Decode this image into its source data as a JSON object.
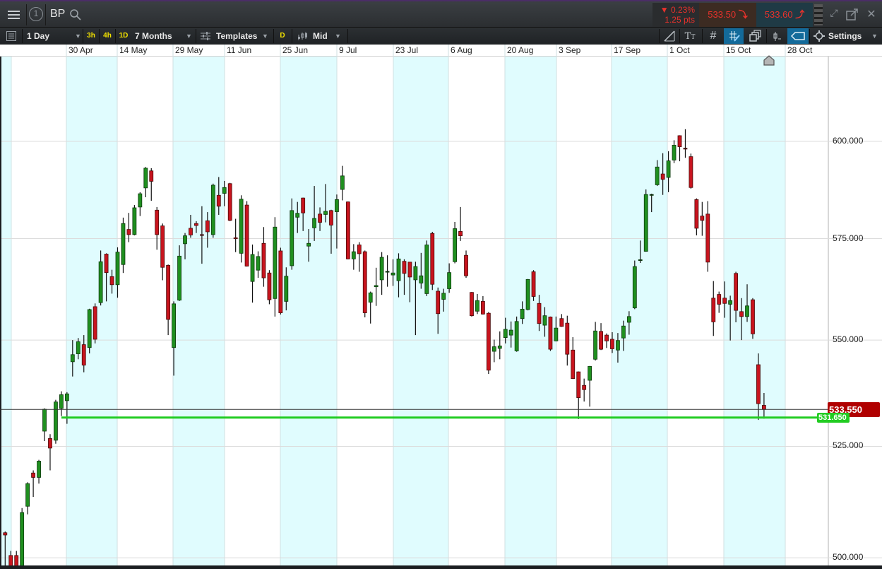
{
  "header": {
    "menu_icon": "hamburger-icon",
    "layout_number": "1",
    "symbol": "BP",
    "change_pct": "▼ 0.23%",
    "change_pts": "1.25 pts",
    "sell_price": "533.50",
    "buy_price": "533.60",
    "colors": {
      "down": "#e8322c",
      "sell_bg": "#3c2b22",
      "buy_bg": "#1f3a45"
    }
  },
  "toolbar": {
    "interval": "1 Day",
    "quick_intervals": [
      "3h",
      "4h",
      "1D"
    ],
    "range": "7 Months",
    "templates": "Templates",
    "d_badge": "D",
    "price_type": "Mid",
    "settings": "Settings"
  },
  "chart_data": {
    "type": "candlestick",
    "title": "BP",
    "scale": "log",
    "ylim": [
      499,
      625.8
    ],
    "x_tick_labels": [
      "30 Apr",
      "14 May",
      "29 May",
      "11 Jun",
      "25 Jun",
      "9 Jul",
      "23 Jul",
      "6 Aug",
      "20 Aug",
      "3 Sep",
      "17 Sep",
      "1 Oct",
      "15 Oct",
      "28 Oct"
    ],
    "y_ticks": [
      600,
      575,
      550,
      525,
      500
    ],
    "y_tick_labels": [
      "600.000",
      "575.000",
      "550.000",
      "525.000",
      "500.000"
    ],
    "current_price": 533.55,
    "current_price_label": "533.550",
    "horizontal_line": 531.65,
    "horizontal_line_label": "531.650",
    "colors": {
      "up": "#1f8f1f",
      "down": "#c8141e",
      "line": "#22cc22",
      "current": "#b00000"
    },
    "ohlc_fields": [
      "open",
      "high",
      "low",
      "close"
    ],
    "candles": [
      [
        505.5,
        505.8,
        498,
        505
      ],
      [
        500.5,
        501.5,
        497,
        498
      ],
      [
        500.5,
        501.5,
        497,
        498
      ],
      [
        498,
        511,
        497,
        510
      ],
      [
        511.4,
        516.8,
        509.6,
        516.5
      ],
      [
        518.9,
        519.5,
        513.5,
        517.9
      ],
      [
        517.9,
        521.9,
        516.5,
        521.6
      ],
      [
        528.5,
        533.8,
        526.2,
        533.6
      ],
      [
        526.8,
        527.8,
        519.5,
        524.6
      ],
      [
        526.4,
        535.8,
        525.6,
        535.3
      ],
      [
        533.8,
        537.8,
        532,
        537
      ],
      [
        535.6,
        537.6,
        530.2,
        537.2
      ],
      [
        544.8,
        550,
        541.3,
        546.5
      ],
      [
        546.7,
        550.5,
        545.4,
        549.6
      ],
      [
        548.9,
        551.2,
        542.3,
        544
      ],
      [
        548.2,
        557.6,
        546.8,
        557.4
      ],
      [
        558.1,
        558.9,
        549.2,
        550.2
      ],
      [
        559.1,
        572,
        558.4,
        569.2
      ],
      [
        571.1,
        571.3,
        559.4,
        566.5
      ],
      [
        565.5,
        567.2,
        561.3,
        563.5
      ],
      [
        563.5,
        572.8,
        560.3,
        571.6
      ],
      [
        568.5,
        580.3,
        566.4,
        578.8
      ],
      [
        577.3,
        581.5,
        574.1,
        576
      ],
      [
        576,
        583.5,
        575.8,
        582.8
      ],
      [
        583,
        586.8,
        580.7,
        586.4
      ],
      [
        587.9,
        593.3,
        585.5,
        593
      ],
      [
        592.3,
        593,
        584.6,
        589.6
      ],
      [
        582.2,
        583,
        572.2,
        576
      ],
      [
        578.2,
        578.8,
        564.6,
        567.8
      ],
      [
        568.3,
        568.5,
        551.2,
        555
      ],
      [
        548.2,
        559.4,
        541.5,
        558.8
      ],
      [
        559.7,
        573.3,
        559.5,
        570.6
      ],
      [
        573.7,
        576.4,
        569.8,
        575.7
      ],
      [
        577.6,
        581,
        575.2,
        575.9
      ],
      [
        578.8,
        579.4,
        576.4,
        578.3
      ],
      [
        576,
        583.2,
        568.7,
        575.9
      ],
      [
        579.5,
        581.7,
        572.7,
        576.7
      ],
      [
        576,
        589,
        575.2,
        588.6
      ],
      [
        586,
        590.7,
        581,
        583.2
      ],
      [
        586.5,
        589.7,
        583.2,
        588
      ],
      [
        589,
        589.2,
        579.4,
        579.6
      ],
      [
        575.2,
        580,
        571.6,
        575
      ],
      [
        571.3,
        586,
        569,
        585
      ],
      [
        583.5,
        584.5,
        568,
        568.1
      ],
      [
        564.3,
        573.5,
        559.1,
        571
      ],
      [
        567.1,
        571.8,
        565.2,
        570.5
      ],
      [
        573.8,
        577.9,
        563,
        565.2
      ],
      [
        566.4,
        567.1,
        558.7,
        559.8
      ],
      [
        560.1,
        580.4,
        555.7,
        577.9
      ],
      [
        571.9,
        572.7,
        556.2,
        556.6
      ],
      [
        559.4,
        567.8,
        557.2,
        565.6
      ],
      [
        568.2,
        585.2,
        567.2,
        582.1
      ],
      [
        580.4,
        584.3,
        576.4,
        581.4
      ],
      [
        585.3,
        585.4,
        576.9,
        581.5
      ],
      [
        573.1,
        577.4,
        569.2,
        573.8
      ],
      [
        577.7,
        588.4,
        574.4,
        580.1
      ],
      [
        581.2,
        582.9,
        576.9,
        579.1
      ],
      [
        581.1,
        588.9,
        579.1,
        581.9
      ],
      [
        582.1,
        582.3,
        571.2,
        578.4
      ],
      [
        581.8,
        586.2,
        572.5,
        584.9
      ],
      [
        587.5,
        593.6,
        584.7,
        591
      ],
      [
        584.3,
        584.4,
        569.8,
        569.9
      ],
      [
        569.9,
        573.6,
        567.2,
        571.7
      ],
      [
        573.4,
        574.1,
        566.7,
        571.2
      ],
      [
        571.7,
        572,
        555.5,
        556.6
      ],
      [
        559.2,
        561.8,
        554,
        561.5
      ],
      [
        563,
        567.7,
        558.3,
        563.3
      ],
      [
        564.7,
        571.6,
        561,
        570.3
      ],
      [
        566.7,
        570.8,
        563,
        566.8
      ],
      [
        565.9,
        569.8,
        563.2,
        566.4
      ],
      [
        564.5,
        571.3,
        560.4,
        569.9
      ],
      [
        569.3,
        569.8,
        561,
        566.3
      ],
      [
        569.1,
        569.1,
        559.2,
        565.4
      ],
      [
        564.7,
        569.2,
        551.2,
        568
      ],
      [
        563.9,
        571.4,
        562.5,
        565.7
      ],
      [
        561.3,
        574.5,
        560.7,
        573.4
      ],
      [
        576.3,
        576.7,
        562.2,
        563.6
      ],
      [
        561.9,
        562.8,
        551.5,
        556.4
      ],
      [
        559.9,
        562.5,
        556.9,
        561.4
      ],
      [
        562.5,
        568.8,
        561.5,
        566.5
      ],
      [
        569.2,
        579.2,
        568.8,
        577.5
      ],
      [
        576.8,
        583,
        574.4,
        575.7
      ],
      [
        570.8,
        572,
        565.2,
        565.7
      ],
      [
        561.6,
        561.7,
        555.7,
        555.9
      ],
      [
        557,
        561.2,
        556.3,
        559.6
      ],
      [
        559.4,
        560.7,
        556.2,
        556.3
      ],
      [
        556.5,
        556.8,
        541.9,
        542.8
      ],
      [
        547.3,
        550.1,
        544.7,
        548.4
      ],
      [
        548,
        552.1,
        545.4,
        548.6
      ],
      [
        550.6,
        555.4,
        549.2,
        552.6
      ],
      [
        551.2,
        554.5,
        548.2,
        552.4
      ],
      [
        547.4,
        555.7,
        547.2,
        554.5
      ],
      [
        555.2,
        559.4,
        553.9,
        557.5
      ],
      [
        557.4,
        564.9,
        557.2,
        564.8
      ],
      [
        566.7,
        567.1,
        559.5,
        560.6
      ],
      [
        558.9,
        561,
        552.2,
        554
      ],
      [
        553.6,
        558,
        550.8,
        555.9
      ],
      [
        555.6,
        555.7,
        547.4,
        547.8
      ],
      [
        549.8,
        555.7,
        549.7,
        552.9
      ],
      [
        555.2,
        556.3,
        553.2,
        553.3
      ],
      [
        554.1,
        555.9,
        543.9,
        546.6
      ],
      [
        547.6,
        550.7,
        540.7,
        540.8
      ],
      [
        542.4,
        542.5,
        531.3,
        536.3
      ],
      [
        539.2,
        540.8,
        535.4,
        538.2
      ],
      [
        540.4,
        543.8,
        534.2,
        543.7
      ],
      [
        545.4,
        554.4,
        545.1,
        552.2
      ],
      [
        552.1,
        554.1,
        547.6,
        547.8
      ],
      [
        551.2,
        551.6,
        548.1,
        549.8
      ],
      [
        550.2,
        551.9,
        546.9,
        547.9
      ],
      [
        547.6,
        551.7,
        544.6,
        549.9
      ],
      [
        550.5,
        554.7,
        547.4,
        553.4
      ],
      [
        554.3,
        557,
        551.3,
        555.7
      ],
      [
        557.8,
        569.5,
        557.5,
        568
      ],
      [
        569.6,
        574.5,
        568.9,
        569.7
      ],
      [
        571.8,
        587.5,
        571.7,
        586.2
      ],
      [
        586.1,
        586.4,
        581.7,
        586.2
      ],
      [
        588.7,
        595.1,
        588.4,
        593.3
      ],
      [
        591.5,
        596.9,
        586.1,
        590.1
      ],
      [
        590.6,
        597.4,
        586.8,
        594.9
      ],
      [
        595.1,
        600.3,
        594.3,
        599
      ],
      [
        601.5,
        601.6,
        594.8,
        598.6
      ],
      [
        598.2,
        603.2,
        595.7,
        598.1
      ],
      [
        596,
        596.8,
        587.7,
        588
      ],
      [
        584.9,
        585.2,
        575.8,
        577.6
      ],
      [
        580.7,
        584.3,
        575.7,
        579.6
      ],
      [
        581.2,
        584.5,
        566.7,
        569.1
      ],
      [
        560.2,
        564.4,
        551,
        554.4
      ],
      [
        561.1,
        561.8,
        556.6,
        558.7
      ],
      [
        560.2,
        564.3,
        555.4,
        558.9
      ],
      [
        558.7,
        560.8,
        549.9,
        559.6
      ],
      [
        566.3,
        566.7,
        554.3,
        557.2
      ],
      [
        556.9,
        560.2,
        550,
        555.7
      ],
      [
        555.7,
        563.6,
        554.4,
        558.3
      ],
      [
        559.8,
        560.2,
        550.3,
        551.5
      ],
      [
        544.1,
        546.8,
        531.1,
        534.9
      ],
      [
        534.5,
        537.4,
        531.4,
        533.55
      ]
    ]
  }
}
